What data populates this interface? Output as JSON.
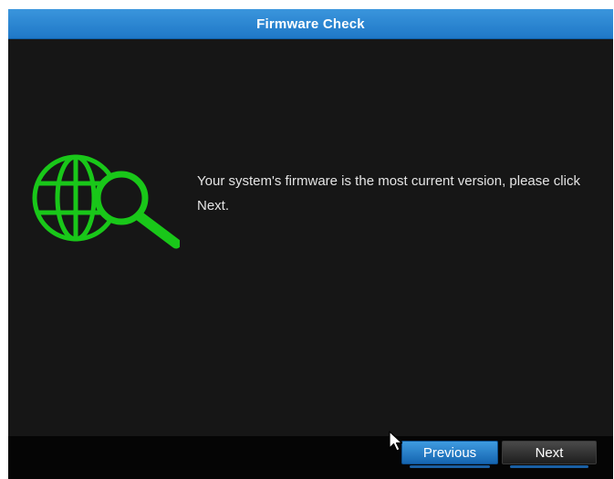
{
  "dialog": {
    "title": "Firmware Check",
    "message": "Your system's firmware is the most current version, please click Next."
  },
  "buttons": {
    "previous_label": "Previous",
    "next_label": "Next"
  },
  "icons": {
    "main_icon": "globe-magnifier-icon",
    "cursor": "mouse-pointer-icon"
  },
  "colors": {
    "title_bar": "#2584d2",
    "background": "#161616",
    "icon_green": "#19c719",
    "previous_button": "#2a7fd0",
    "next_button": "#333333"
  }
}
